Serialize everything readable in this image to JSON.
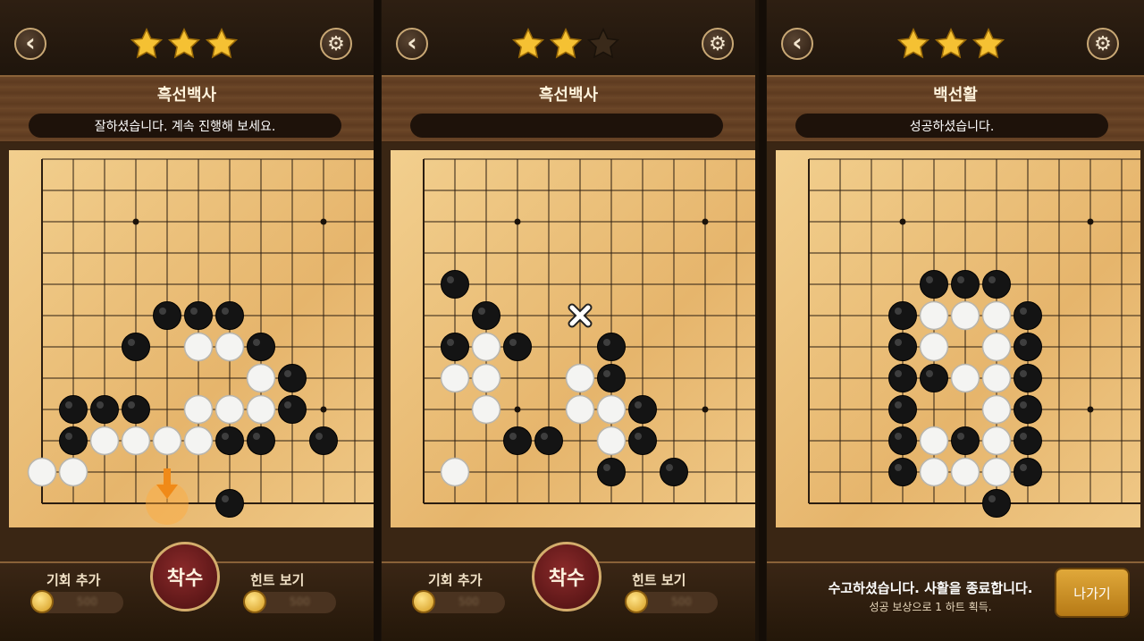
{
  "colors": {
    "accent": "#c9a875",
    "star_filled": "#f5c133",
    "star_empty": "#3a2a1a",
    "button_red": "#6a1a1a",
    "exit_button": "#d39a2a"
  },
  "icons": {
    "back": "chevron-left-icon",
    "settings": "gear-icon",
    "coin": "coin-icon",
    "close": "x-mark-icon",
    "hint_arrow": "arrow-down-icon"
  },
  "panels": [
    {
      "stars": 3,
      "title": "흑선백사",
      "message": "잘하셨습니다. 계속 진행해 보세요.",
      "bottom": {
        "add_chance": "기회 추가",
        "move": "착수",
        "hint": "힌트 보기",
        "add_chance_cost": "500",
        "hint_cost": "500"
      },
      "board": {
        "black": [
          [
            4,
            5
          ],
          [
            5,
            5
          ],
          [
            6,
            5
          ],
          [
            3,
            6
          ],
          [
            7,
            6
          ],
          [
            8,
            7
          ],
          [
            1,
            8
          ],
          [
            2,
            8
          ],
          [
            3,
            8
          ],
          [
            8,
            8
          ],
          [
            1,
            9
          ],
          [
            6,
            9
          ],
          [
            7,
            9
          ],
          [
            9,
            9
          ],
          [
            6,
            11
          ]
        ],
        "white": [
          [
            5,
            6
          ],
          [
            6,
            6
          ],
          [
            7,
            7
          ],
          [
            5,
            8
          ],
          [
            6,
            8
          ],
          [
            7,
            8
          ],
          [
            2,
            9
          ],
          [
            3,
            9
          ],
          [
            4,
            9
          ],
          [
            5,
            9
          ],
          [
            0,
            10
          ],
          [
            1,
            10
          ]
        ],
        "hint_arrow": [
          4,
          10
        ]
      }
    },
    {
      "stars": 2,
      "title": "흑선백사",
      "message": "",
      "bottom": {
        "add_chance": "기회 추가",
        "move": "착수",
        "hint": "힌트 보기",
        "add_chance_cost": "500",
        "hint_cost": "500"
      },
      "board": {
        "black": [
          [
            1,
            4
          ],
          [
            2,
            5
          ],
          [
            1,
            6
          ],
          [
            3,
            6
          ],
          [
            6,
            6
          ],
          [
            6,
            7
          ],
          [
            7,
            8
          ],
          [
            3,
            9
          ],
          [
            4,
            9
          ],
          [
            7,
            9
          ],
          [
            6,
            10
          ],
          [
            8,
            10
          ]
        ],
        "white": [
          [
            2,
            6
          ],
          [
            1,
            7
          ],
          [
            2,
            7
          ],
          [
            5,
            7
          ],
          [
            2,
            8
          ],
          [
            5,
            8
          ],
          [
            6,
            8
          ],
          [
            6,
            9
          ],
          [
            1,
            10
          ]
        ],
        "x_mark": [
          5,
          5
        ]
      }
    },
    {
      "stars": 3,
      "title": "백선활",
      "message": "성공하셨습니다.",
      "bottom": {
        "end_message": "수고하셨습니다. 사활을 종료합니다.",
        "end_sub": "성공 보상으로 1 하트 획득.",
        "exit": "나가기"
      },
      "board": {
        "black": [
          [
            4,
            4
          ],
          [
            5,
            4
          ],
          [
            6,
            4
          ],
          [
            3,
            5
          ],
          [
            7,
            5
          ],
          [
            3,
            6
          ],
          [
            7,
            6
          ],
          [
            3,
            7
          ],
          [
            4,
            7
          ],
          [
            7,
            7
          ],
          [
            3,
            8
          ],
          [
            7,
            8
          ],
          [
            3,
            9
          ],
          [
            5,
            9
          ],
          [
            7,
            9
          ],
          [
            3,
            10
          ],
          [
            7,
            10
          ],
          [
            6,
            11
          ]
        ],
        "white": [
          [
            4,
            5
          ],
          [
            5,
            5
          ],
          [
            6,
            5
          ],
          [
            4,
            6
          ],
          [
            6,
            6
          ],
          [
            5,
            7
          ],
          [
            6,
            7
          ],
          [
            6,
            8
          ],
          [
            4,
            9
          ],
          [
            6,
            9
          ],
          [
            4,
            10
          ],
          [
            5,
            10
          ],
          [
            6,
            10
          ]
        ]
      }
    }
  ]
}
